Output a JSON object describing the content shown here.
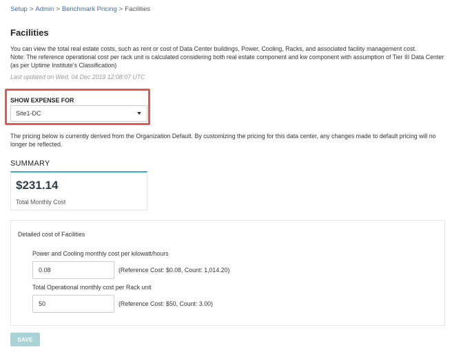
{
  "breadcrumb": {
    "items": [
      "Setup",
      "Admin",
      "Benchmark Pricing"
    ],
    "separator": ">",
    "current": "Facilities"
  },
  "page": {
    "title": "Facilities",
    "description_line1": "You can view the total real estate costs, such as rent or cost of Data Center buildings, Power, Cooling, Racks, and associated facility management cost.",
    "description_line2": "Note: The reference operational cost per rack unit is calculated considering both real estate component and kw component with assumption of Tier III Data Center (as per Uptime Institute's Classification)",
    "last_updated": "Last updated on Wed, 04 Dec 2019 12:08:07 UTC"
  },
  "expense": {
    "label": "SHOW EXPENSE FOR",
    "selected": "Site1-DC",
    "highlight_color": "#e8574f"
  },
  "pricing_note": "The pricing below is currently derived from the Organization Default. By customizing the pricing for this data center, any changes made to default pricing will no longer be reflected.",
  "summary": {
    "heading": "SUMMARY",
    "amount": "$231.14",
    "caption": "Total Monthly Cost",
    "accent_color": "#3fa7d6"
  },
  "details": {
    "title": "Detailed cost of Facilities",
    "fields": [
      {
        "label": "Power and Cooling monthly cost per kilowatt/hours",
        "value": "0.08",
        "reference": "(Reference Cost: $0.08, Count: 1,014.20)"
      },
      {
        "label": "Total Operational monthly cost per Rack unit",
        "value": "50",
        "reference": "(Reference Cost: $50, Count: 3.00)"
      }
    ]
  },
  "actions": {
    "save_label": "SAVE",
    "save_color": "#a9d3d6"
  }
}
